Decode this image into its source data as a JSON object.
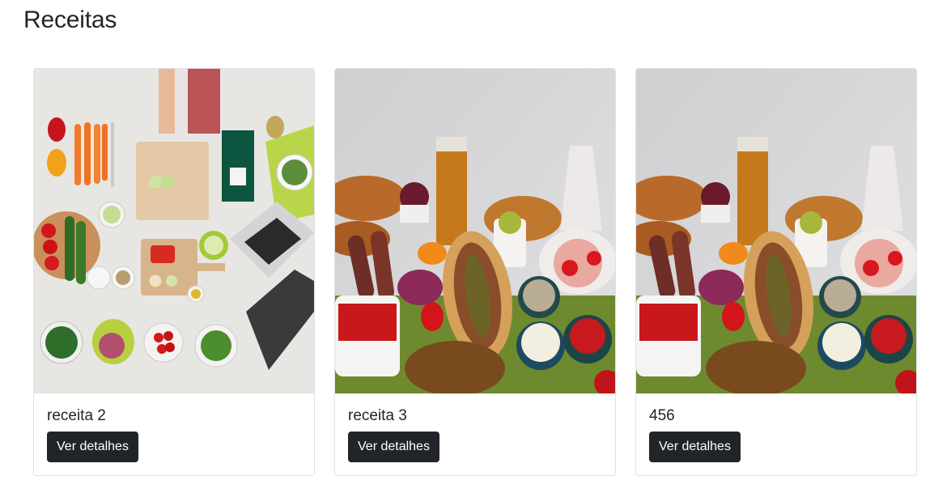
{
  "page": {
    "title": "Receitas"
  },
  "cards": [
    {
      "title": "receita 2",
      "button_label": "Ver detalhes",
      "image": "kitchen-prep-photo"
    },
    {
      "title": "receita 3",
      "button_label": "Ver detalhes",
      "image": "turkish-food-spread-photo"
    },
    {
      "title": "456",
      "button_label": "Ver detalhes",
      "image": "turkish-food-spread-photo"
    }
  ]
}
